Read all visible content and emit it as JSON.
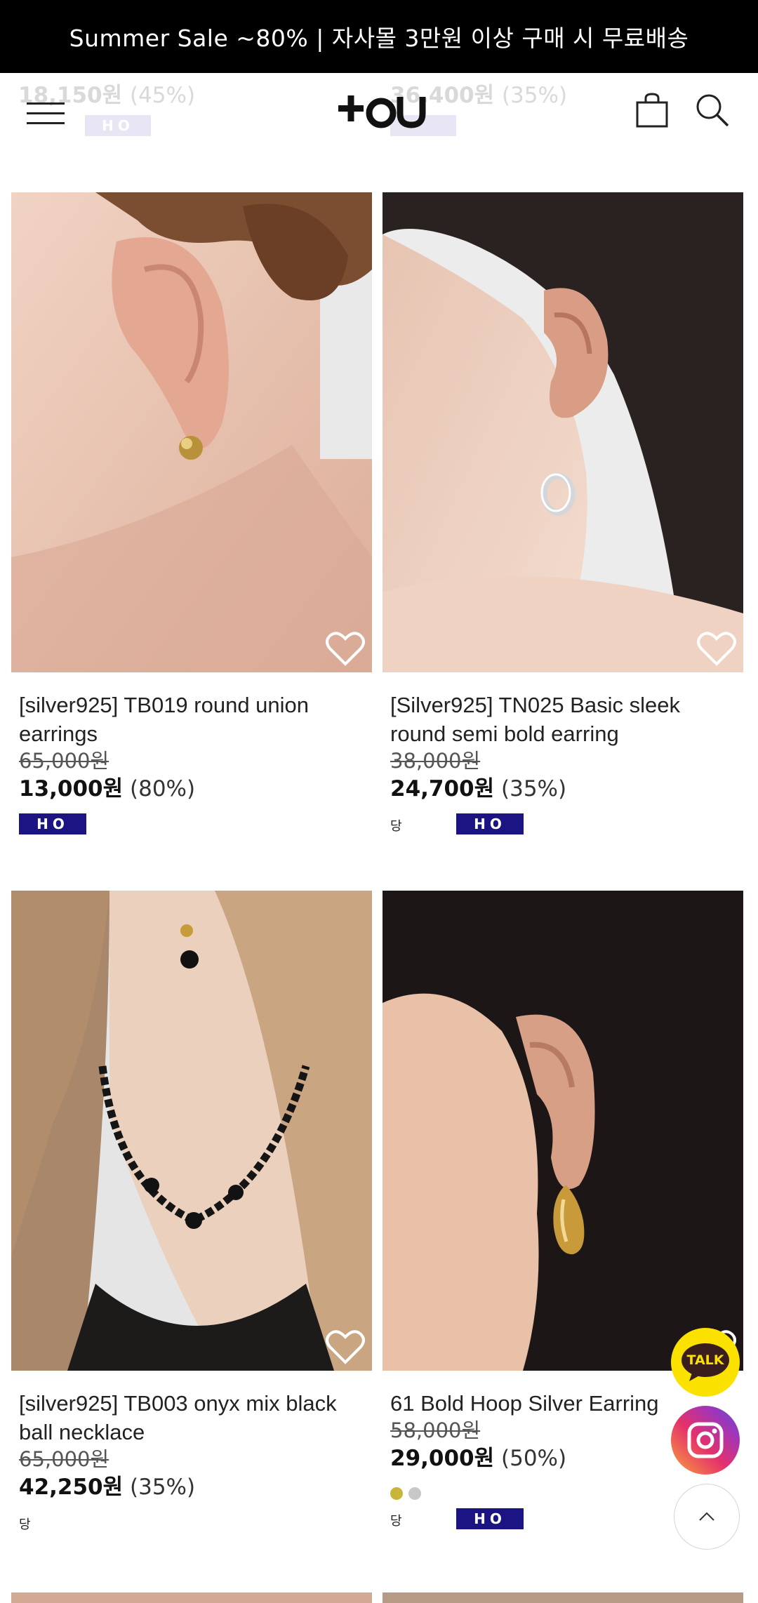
{
  "promo_bar": {
    "text": "Summer Sale ~80%  |  자사몰 3만원 이상 구매 시 무료배송"
  },
  "header": {
    "logo_text": "+oU",
    "menu_icon": "hamburger-menu-icon",
    "cart_icon": "shopping-bag-icon",
    "search_icon": "search-icon"
  },
  "previous_row": [
    {
      "sale_price": "18,150원",
      "discount": "(45%)",
      "badge": "HO"
    },
    {
      "sale_price": "36,400원",
      "discount": "(35%)"
    }
  ],
  "products": [
    {
      "name": "[silver925] TB019 round union earrings",
      "original_price": "65,000원",
      "sale_price": "13,000원",
      "discount": "(80%)",
      "badges": [
        "HO"
      ]
    },
    {
      "name": "[Silver925] TN025 Basic sleek round semi bold earring",
      "original_price": "38,000원",
      "sale_price": "24,700원",
      "discount": "(35%)",
      "dang_label": "당",
      "badges": [
        "HO"
      ]
    },
    {
      "name": "[silver925] TB003 onyx mix black ball necklace",
      "original_price": "65,000원",
      "sale_price": "42,250원",
      "discount": "(35%)",
      "dang_label": "당"
    },
    {
      "name": "61 Bold Hoop Silver Earring",
      "original_price": "58,000원",
      "sale_price": "29,000원",
      "discount": "(50%)",
      "colors": [
        "#c9b53a",
        "#c8c8c8"
      ],
      "dang_label": "당",
      "badges": [
        "HO"
      ]
    }
  ],
  "floating": {
    "talk_label": "TALK",
    "instagram_icon": "instagram-icon",
    "scroll_top_icon": "chevron-up-icon"
  },
  "colors": {
    "promo_bg": "#000000",
    "badge_bg": "#1c1483",
    "talk_bg": "#fae100"
  }
}
